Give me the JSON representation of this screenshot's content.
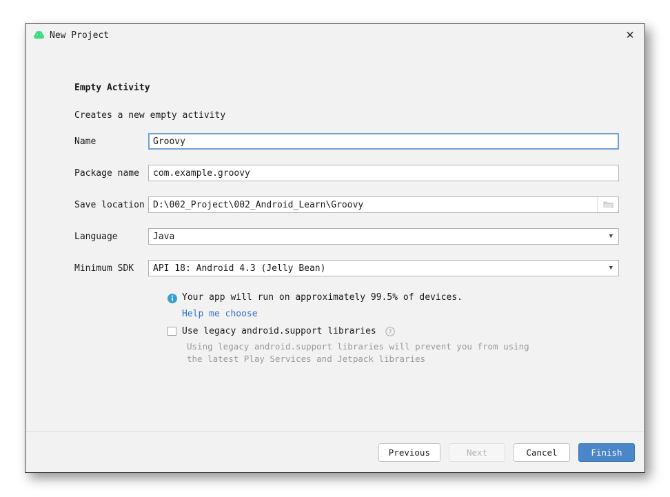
{
  "window": {
    "title": "New Project",
    "icon": "android-robot-icon",
    "close_label": "✕"
  },
  "template": {
    "heading": "Empty Activity",
    "subheading": "Creates a new empty activity"
  },
  "fields": {
    "name": {
      "label": "Name",
      "value": "Groovy",
      "focused": true
    },
    "package_name": {
      "label": "Package name",
      "value": "com.example.groovy"
    },
    "save_location": {
      "label": "Save location",
      "value": "D:\\002_Project\\002_Android_Learn\\Groovy",
      "browse_icon": "folder-icon"
    },
    "language": {
      "label": "Language",
      "value": "Java",
      "arrow": "▼"
    },
    "minimum_sdk": {
      "label": "Minimum SDK",
      "value": "API 18: Android 4.3 (Jelly Bean)",
      "arrow": "▼"
    }
  },
  "info": {
    "icon": "info-icon",
    "text": "Your app will run on approximately 99.5% of devices.",
    "percent": "99.5%",
    "link": "Help me choose"
  },
  "legacy": {
    "checked": false,
    "label": "Use legacy android.support libraries",
    "help_icon": "question-mark-icon",
    "description_line1": "Using legacy android.support libraries will prevent you from using",
    "description_line2": "the latest Play Services and Jetpack libraries"
  },
  "footer": {
    "previous": "Previous",
    "next": "Next",
    "next_disabled": true,
    "cancel": "Cancel",
    "finish": "Finish"
  },
  "colors": {
    "dialog_bg": "#f2f2f2",
    "accent_blue": "#4a86c8",
    "focus_blue": "#6fa1d7",
    "link_blue": "#2f72c6",
    "android_green": "#3ddc84",
    "muted_text": "#9a9a9a"
  }
}
